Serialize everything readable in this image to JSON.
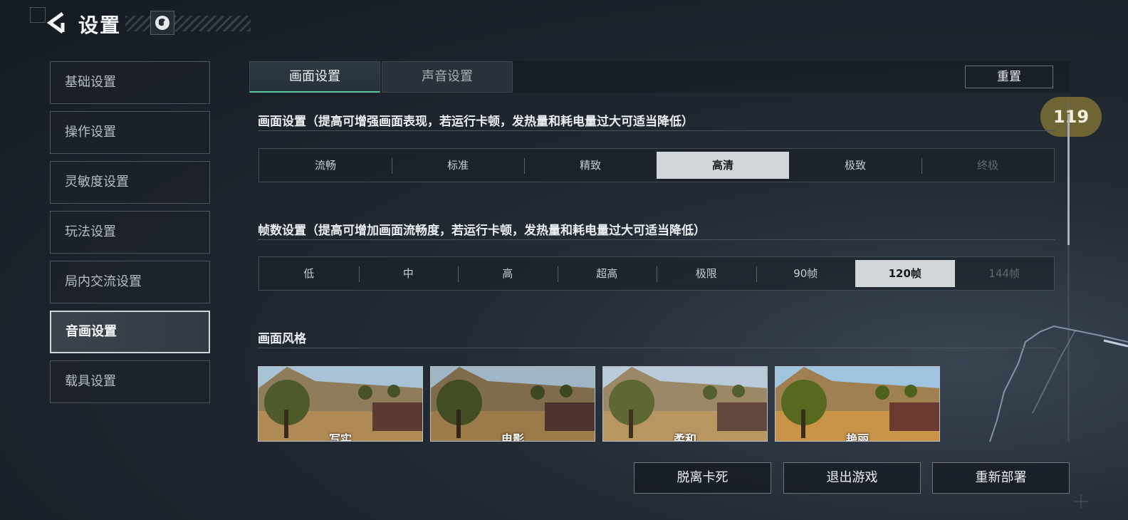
{
  "header": {
    "title": "设置",
    "back_icon": "back-arrow-icon",
    "title_icon": "emblem-icon"
  },
  "sidebar": {
    "items": [
      {
        "label": "基础设置",
        "active": false
      },
      {
        "label": "操作设置",
        "active": false
      },
      {
        "label": "灵敏度设置",
        "active": false
      },
      {
        "label": "玩法设置",
        "active": false
      },
      {
        "label": "局内交流设置",
        "active": false
      },
      {
        "label": "音画设置",
        "active": true
      },
      {
        "label": "载具设置",
        "active": false
      }
    ]
  },
  "tabs": [
    {
      "label": "画面设置",
      "active": true
    },
    {
      "label": "声音设置",
      "active": false
    }
  ],
  "reset_label": "重置",
  "fps_badge": "119",
  "quality": {
    "title": "画面设置（提高可增强画面表现，若运行卡顿，发热量和耗电量过大可适当降低）",
    "options": [
      "流畅",
      "标准",
      "精致",
      "高清",
      "极致",
      "终极"
    ],
    "selected": "高清",
    "disabled": [
      "终极"
    ]
  },
  "framerate": {
    "title": "帧数设置（提高可增加画面流畅度，若运行卡顿，发热量和耗电量过大可适当降低）",
    "options": [
      "低",
      "中",
      "高",
      "超高",
      "极限",
      "90帧",
      "120帧",
      "144帧"
    ],
    "selected": "120帧",
    "disabled": [
      "144帧"
    ]
  },
  "style": {
    "title": "画面风格",
    "thumbnails": [
      {
        "label": "写实"
      },
      {
        "label": "电影"
      },
      {
        "label": "柔和"
      },
      {
        "label": "艳丽"
      }
    ]
  },
  "bottom_buttons": [
    {
      "label": "脱离卡死"
    },
    {
      "label": "退出游戏"
    },
    {
      "label": "重新部署"
    }
  ],
  "colors": {
    "accent_green": "#5fc89a",
    "fps_badge_bg": "#6e6434",
    "selected_bg": "#d2d6da"
  }
}
